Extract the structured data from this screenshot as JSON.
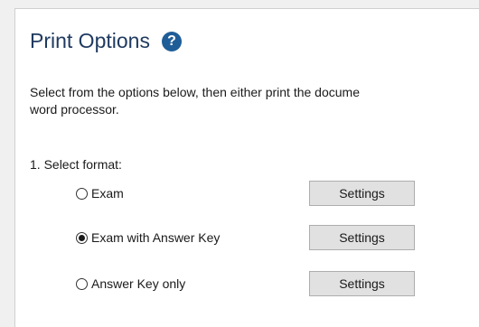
{
  "panel": {
    "title": "Print Options",
    "help_icon": "?",
    "description_lines": [
      "Select from the options below, then either print the docume",
      "word processor."
    ]
  },
  "format": {
    "label": "1. Select format:",
    "options": [
      {
        "label": "Exam",
        "selected": false,
        "button": "Settings"
      },
      {
        "label": "Exam with Answer Key",
        "selected": true,
        "button": "Settings"
      },
      {
        "label": "Answer Key only",
        "selected": false,
        "button": "Settings"
      }
    ]
  }
}
